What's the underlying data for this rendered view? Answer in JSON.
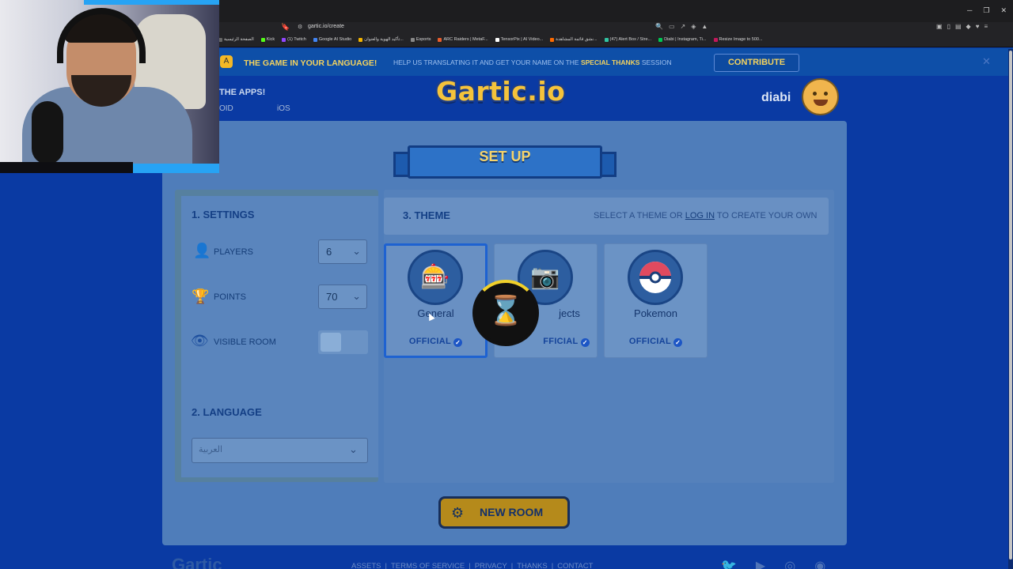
{
  "browser": {
    "url": "gartic.io/create",
    "bookmarks": [
      {
        "label": "الصفحة الرئيسية",
        "color": "#666666"
      },
      {
        "label": "Kick",
        "color": "#53fc18"
      },
      {
        "label": "(1) Twitch",
        "color": "#9146ff"
      },
      {
        "label": "Google AI Studio",
        "color": "#4285f4"
      },
      {
        "label": "تأكيد الهوية والعنوان...",
        "color": "#f4b400"
      },
      {
        "label": "Esports",
        "color": "#888888"
      },
      {
        "label": "ARC Raiders | MetaF...",
        "color": "#e85d2c"
      },
      {
        "label": "TensorPix | AI Video...",
        "color": "#ffffff"
      },
      {
        "label": "نشق قائمة المشاهدة...",
        "color": "#ff6a00"
      },
      {
        "label": "(47) Alert Box / Stre...",
        "color": "#31c3a2"
      },
      {
        "label": "Diabi | Instagram, Ti...",
        "color": "#00c853"
      },
      {
        "label": "Resize Image to 500...",
        "color": "#c2185b"
      }
    ]
  },
  "announcement": {
    "title": "THE GAME IN YOUR LANGUAGE!",
    "text_before": "HELP US TRANSLATING IT AND GET YOUR NAME ON THE",
    "text_highlight": "SPECIAL THANKS",
    "text_after": "SESSION",
    "cta": "CONTRIBUTE",
    "close": "✕"
  },
  "header": {
    "apps_label": "THE APPS!",
    "android_label": "OID",
    "ios_label": "iOS",
    "logo": "Gartic.io",
    "username": "diabi"
  },
  "setup": {
    "title": "SET UP",
    "settings": {
      "heading": "1. SETTINGS",
      "players_label": "PLAYERS",
      "players_value": "6",
      "points_label": "POINTS",
      "points_value": "70",
      "visible_room_label": "VISIBLE ROOM",
      "visible_room_on": false
    },
    "language": {
      "heading": "2. LANGUAGE",
      "value": "العربية"
    },
    "theme": {
      "heading": "3. THEME",
      "hint_before": "SELECT A THEME OR",
      "hint_link": "LOG IN",
      "hint_after": "TO CREATE YOUR OWN",
      "tiles": [
        {
          "name": "General",
          "badge": "OFFICIAL",
          "selected": true,
          "icon": "slot-machine-icon"
        },
        {
          "name": "Objects",
          "badge": "OFFICIAL",
          "selected": false,
          "icon": "camera-icon"
        },
        {
          "name": "Pokemon",
          "badge": "OFFICIAL",
          "selected": false,
          "icon": "pokeball-icon"
        }
      ],
      "selected_name_visible": "General",
      "objects_name_visible": "jects",
      "objects_badge_visible": "FFICIAL"
    },
    "new_room": "NEW ROOM"
  },
  "footer": {
    "logo": "Gartic",
    "links": [
      "ASSETS",
      "|",
      "TERMS OF SERVICE",
      "|",
      "PRIVACY",
      "|",
      "THANKS",
      "|",
      "CONTACT"
    ]
  },
  "colors": {
    "background": "#0a3aa3",
    "accent_yellow": "#f5c33b",
    "selected_border": "#1e62d1"
  }
}
